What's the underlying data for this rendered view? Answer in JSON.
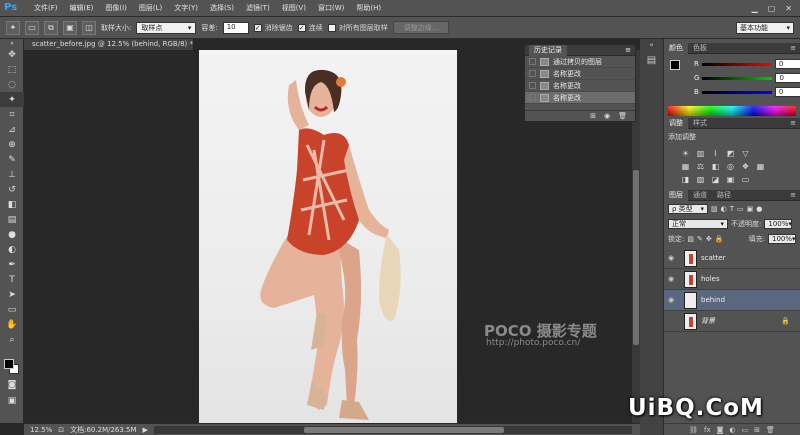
{
  "menubar": {
    "logo": "Ps",
    "items": [
      "文件(F)",
      "编辑(E)",
      "图像(I)",
      "图层(L)",
      "文字(Y)",
      "选择(S)",
      "滤镜(T)",
      "视图(V)",
      "窗口(W)",
      "帮助(H)"
    ]
  },
  "options": {
    "sample_size_label": "取样大小:",
    "sample_size_value": "取样点",
    "tolerance_label": "容差:",
    "tolerance_value": "10",
    "antialias_label": "消除锯齿",
    "contiguous_label": "连续",
    "all_layers_label": "对所有图层取样",
    "refine_edge_label": "调整边缘...",
    "workspace_value": "基本功能"
  },
  "document": {
    "tab_title": "scatter_before.jpg @ 12.5% (behind, RGB/8) *",
    "close": "×",
    "zoom": "12.5%",
    "doc_size": "文档:60.2M/263.5M"
  },
  "history": {
    "tab": "历史记录",
    "menu": "≡",
    "rows": [
      "通过拷贝的图层",
      "名称更改",
      "名称更改",
      "名称更改"
    ]
  },
  "color_panel": {
    "tabs": [
      "颜色",
      "色板"
    ],
    "r_label": "R",
    "r_value": "0",
    "g_label": "G",
    "g_value": "0",
    "b_label": "B",
    "b_value": "0"
  },
  "adjustments": {
    "tabs": [
      "调整",
      "样式"
    ],
    "title": "添加调整"
  },
  "layers_panel": {
    "tabs": [
      "图层",
      "通道",
      "路径"
    ],
    "filter_label": "ρ 类型",
    "blend_mode": "正常",
    "opacity_label": "不透明度:",
    "opacity_value": "100%",
    "lock_label": "锁定:",
    "fill_label": "填充:",
    "fill_value": "100%",
    "layers": [
      {
        "name": "scatter",
        "visible": true,
        "active": false
      },
      {
        "name": "holes",
        "visible": true,
        "active": false
      },
      {
        "name": "behind",
        "visible": true,
        "active": true
      },
      {
        "name": "背景",
        "visible": false,
        "active": false
      }
    ]
  },
  "watermark": {
    "brand": "POCO 摄影专题",
    "url": "http://photo.poco.cn/"
  },
  "site_mark": "UiBQ.CoM"
}
